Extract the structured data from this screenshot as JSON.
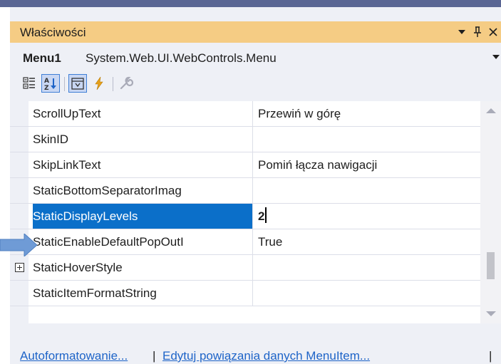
{
  "panel": {
    "title": "Właściwości",
    "title_bar_icons": [
      "dropdown-arrow-icon",
      "pin-icon",
      "close-icon"
    ]
  },
  "selector": {
    "object_name": "Menu1",
    "object_type": "System.Web.UI.WebControls.Menu"
  },
  "toolbar": {
    "buttons": [
      "categorized-icon",
      "alphabetical-icon",
      "properties-icon",
      "events-icon",
      "property-pages-icon"
    ],
    "active": [
      "alphabetical-icon",
      "properties-icon"
    ]
  },
  "properties": [
    {
      "name": "ScrollUpText",
      "value": "Przewiń w górę"
    },
    {
      "name": "SkinID",
      "value": ""
    },
    {
      "name": "SkipLinkText",
      "value": "Pomiń łącza nawigacji"
    },
    {
      "name": "StaticBottomSeparatorImag",
      "value": ""
    },
    {
      "name": "StaticDisplayLevels",
      "value": "2",
      "selected": true
    },
    {
      "name": "StaticEnableDefaultPopOutI",
      "value": "True"
    },
    {
      "name": "StaticHoverStyle",
      "value": "",
      "expandable": true
    },
    {
      "name": "StaticItemFormatString",
      "value": ""
    }
  ],
  "links": [
    {
      "label": "Autoformatowanie..."
    },
    {
      "label": "Edytuj powiązania danych MenuItem..."
    }
  ],
  "colors": {
    "title_bar": "#f5cc84",
    "selected_row": "#0b6fc9",
    "callout_arrow": "#6f9bd6",
    "link": "#1e64c8"
  }
}
